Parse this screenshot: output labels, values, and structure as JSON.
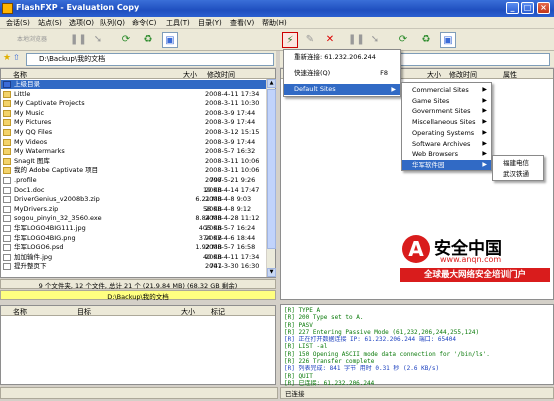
{
  "window": {
    "title": "FlashFXP - Evaluation Copy"
  },
  "menu": [
    "会话(S)",
    "站点(S)",
    "选项(O)",
    "队列(Q)",
    "命令(C)",
    "工具(T)",
    "目录(Y)",
    "查看(V)",
    "帮助(H)"
  ],
  "left_path": "D:\\Backup\\我的文档",
  "headers": {
    "name": "名称",
    "size": "大小",
    "modified": "修改时间",
    "attr": "属性"
  },
  "files": [
    {
      "name": "上级目录",
      "size": "",
      "date": "",
      "type": "up"
    },
    {
      "name": "Little",
      "size": "",
      "date": "2008-4-11 17:34",
      "type": "folder"
    },
    {
      "name": "My Captivate Projects",
      "size": "",
      "date": "2008-3-11 10:30",
      "type": "folder"
    },
    {
      "name": "My Music",
      "size": "",
      "date": "2008-3-9 17:44",
      "type": "folder"
    },
    {
      "name": "My Pictures",
      "size": "",
      "date": "2008-3-9 17:44",
      "type": "folder"
    },
    {
      "name": "My QQ Files",
      "size": "",
      "date": "2008-3-12 15:15",
      "type": "folder"
    },
    {
      "name": "My Videos",
      "size": "",
      "date": "2008-3-9 17:44",
      "type": "folder"
    },
    {
      "name": "My Watermarks",
      "size": "",
      "date": "2008-5-7 16:32",
      "type": "folder"
    },
    {
      "name": "SnagIt 图库",
      "size": "",
      "date": "2008-3-11 10:06",
      "type": "folder"
    },
    {
      "name": "我的 Adobe Captivate 项目",
      "size": "",
      "date": "2008-3-11 10:06",
      "type": "folder"
    },
    {
      "name": ".profile",
      "size": "797",
      "date": "2008-5-21 9:26",
      "type": "file"
    },
    {
      "name": "Doc1.doc",
      "size": "19 KB",
      "date": "2008-4-14 17:47",
      "type": "file"
    },
    {
      "name": "DriverGenius_v2008b3.zip",
      "size": "6.21 MB",
      "date": "2008-4-8 9:03",
      "type": "file"
    },
    {
      "name": "MyDrivers.zip",
      "size": "58 KB",
      "date": "2008-4-8 9:12",
      "type": "file"
    },
    {
      "name": "sogou_pinyin_32_3560.exe",
      "size": "8.84 MB",
      "date": "2008-4-28 11:12",
      "type": "file"
    },
    {
      "name": "华军LOGO4BIG111.jpg",
      "size": "405 KB",
      "date": "2008-5-7 16:24",
      "type": "file"
    },
    {
      "name": "华军LOGO4BIG.png",
      "size": "374 KB",
      "date": "2007-4-6 18:44",
      "type": "file"
    },
    {
      "name": "华军LOGO6.psd",
      "size": "1.92 MB",
      "date": "2008-5-7 16:58",
      "type": "file"
    },
    {
      "name": "加加输件.jpg",
      "size": "40 KB",
      "date": "2008-4-11 17:34",
      "type": "file"
    },
    {
      "name": "提升整页下",
      "size": "741",
      "date": "2007-3-30 16:30",
      "type": "file"
    }
  ],
  "left_status": [
    "9 个文件夹, 12 个文件, 总计 21 个 (21.9.84 MB) (68.32 GB 剩余)",
    "D:\\Backup\\我的文档"
  ],
  "queue_headers": {
    "name": "名称",
    "target": "目标",
    "size": "大小",
    "note": "标记"
  },
  "connect_menu": [
    {
      "label": "重新连接: 61.232.206.244",
      "shortcut": ""
    },
    {
      "label": "快速连接(Q)",
      "shortcut": "F8"
    },
    {
      "label": "Default Sites",
      "shortcut": "",
      "highlight": true
    }
  ],
  "sites_menu": [
    {
      "label": "Commercial Sites"
    },
    {
      "label": "Game Sites"
    },
    {
      "label": "Government Sites"
    },
    {
      "label": "Miscellaneous Sites"
    },
    {
      "label": "Operating Systems"
    },
    {
      "label": "Software Archives"
    },
    {
      "label": "Web Browsers"
    },
    {
      "label": "华军软件园",
      "highlight": true
    }
  ],
  "huajun_menu": [
    {
      "label": "福建电信"
    },
    {
      "label": "武汉铁通"
    }
  ],
  "watermark": {
    "brand": "安全中国",
    "url": "www.anqn.com",
    "slogan": "全球最大网络安全培训门户"
  },
  "log": [
    "[R] TYPE A",
    "[R] 200 Type set to A.",
    "[R] PASV",
    "[R] 227 Entering Passive Mode (61,232,206,244,255,124)",
    "[R] 正在打开数据连接 IP: 61.232.206.244 端口: 65404",
    "[R] LIST -al",
    "[R] 150 Opening ASCII mode data connection for '/bin/ls'.",
    "[R] 226 Transfer complete",
    "[R] 列表完成: 841 字节 用时 0.31 秒 (2.6 KB/s)",
    "[R] QUIT",
    "[R] 已连接: 61.232.206.244"
  ],
  "bottom_status": "已连接"
}
